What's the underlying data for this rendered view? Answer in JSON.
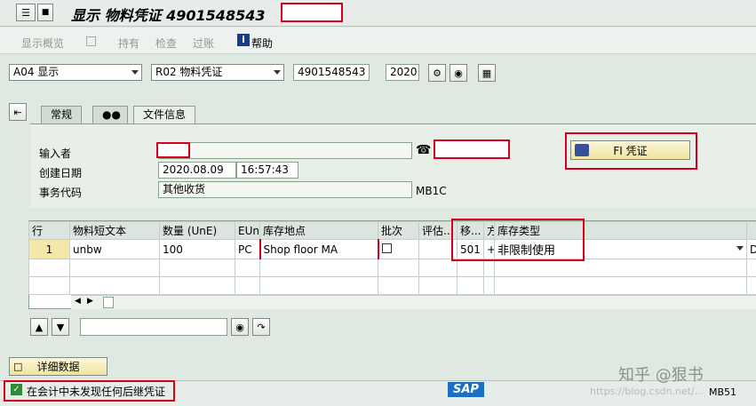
{
  "title_bar": {
    "title": "显示 物料凭证 4901548543"
  },
  "toolbar": {
    "overview": "显示概览",
    "hold": "持有",
    "check": "检查",
    "post": "过账",
    "help": "帮助"
  },
  "header": {
    "action_value": "A04 显示",
    "reference_value": "R02 物料凭证",
    "doc_number": "4901548543",
    "year": "2020"
  },
  "tabs": [
    {
      "label": "常规"
    },
    {
      "label": "文件信息"
    }
  ],
  "doc_info": {
    "entered_by_label": "输入者",
    "created_label": "创建日期",
    "created_date": "2020.08.09",
    "created_time": "16:57:43",
    "tcode_label": "事务代码",
    "tcode_text": "其他收货",
    "tcode_value": "MB1C",
    "fi_button": "FI 凭证"
  },
  "items_table": {
    "columns": [
      "行",
      "物料短文本",
      "数量 (UnE)",
      "EUn",
      "库存地点",
      "批次",
      "评估...",
      "移...",
      "方",
      "库存类型"
    ],
    "row": {
      "line": "1",
      "text": "unbw",
      "qty": "100",
      "unit": "PC",
      "sloc": "Shop floor MA",
      "mvt": "501",
      "dir": "+",
      "stock_type": "非限制使用"
    },
    "extra_col": "D"
  },
  "buttons": {
    "detail": "详细数据"
  },
  "status": {
    "message": "在会计中未发现任何后继凭证",
    "sap_logo": "SAP",
    "tcode": "MB51",
    "watermark": "知乎 @狠书",
    "watermark_url": "https://blog.csdn.net/..."
  }
}
